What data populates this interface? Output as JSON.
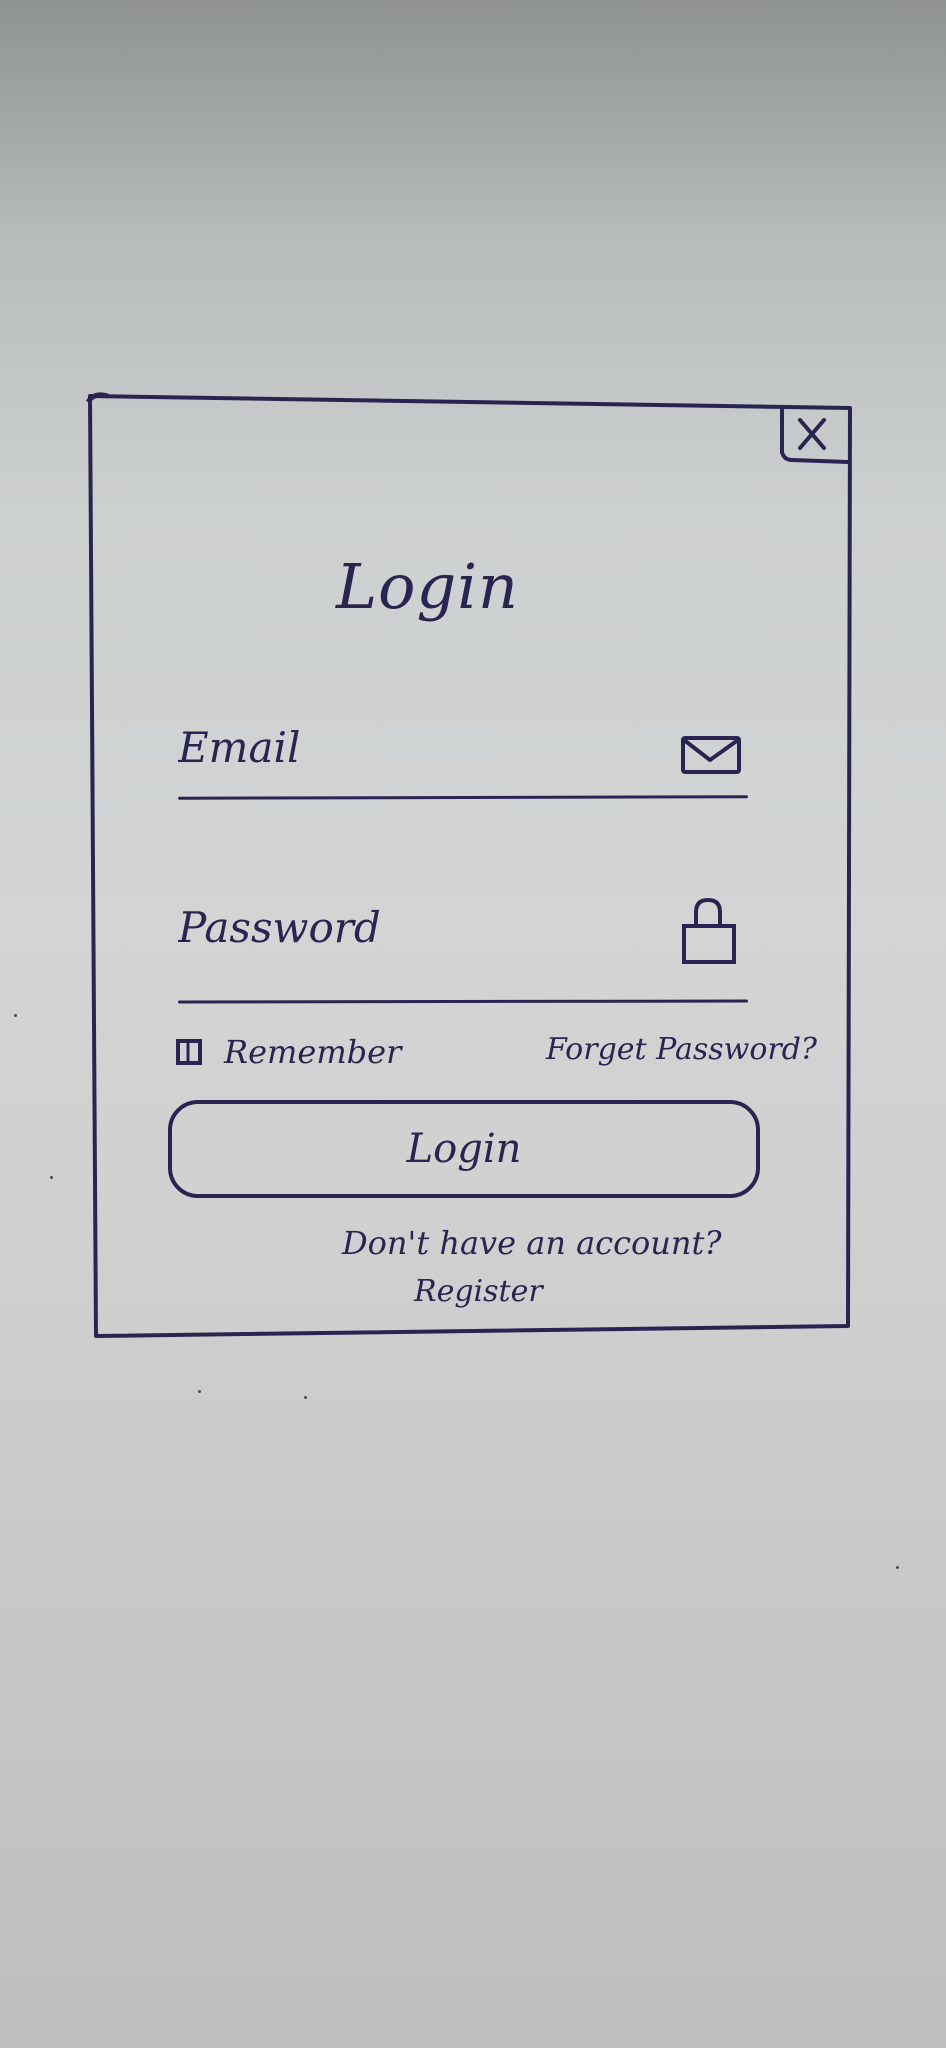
{
  "dialog": {
    "title": "Login",
    "close_label": "X"
  },
  "email": {
    "placeholder": "Email",
    "icon": "mail-icon"
  },
  "password": {
    "placeholder": "Password",
    "icon": "lock-icon"
  },
  "remember": {
    "label": "Remember",
    "checked": false
  },
  "forgot_password": {
    "label": "Forget Password?"
  },
  "login_button": {
    "label": "Login"
  },
  "register_prompt": {
    "text": "Don't have an account?",
    "link_label": "Register"
  },
  "colors": {
    "ink": "#2c2450",
    "paper": "#d3d5d5"
  }
}
